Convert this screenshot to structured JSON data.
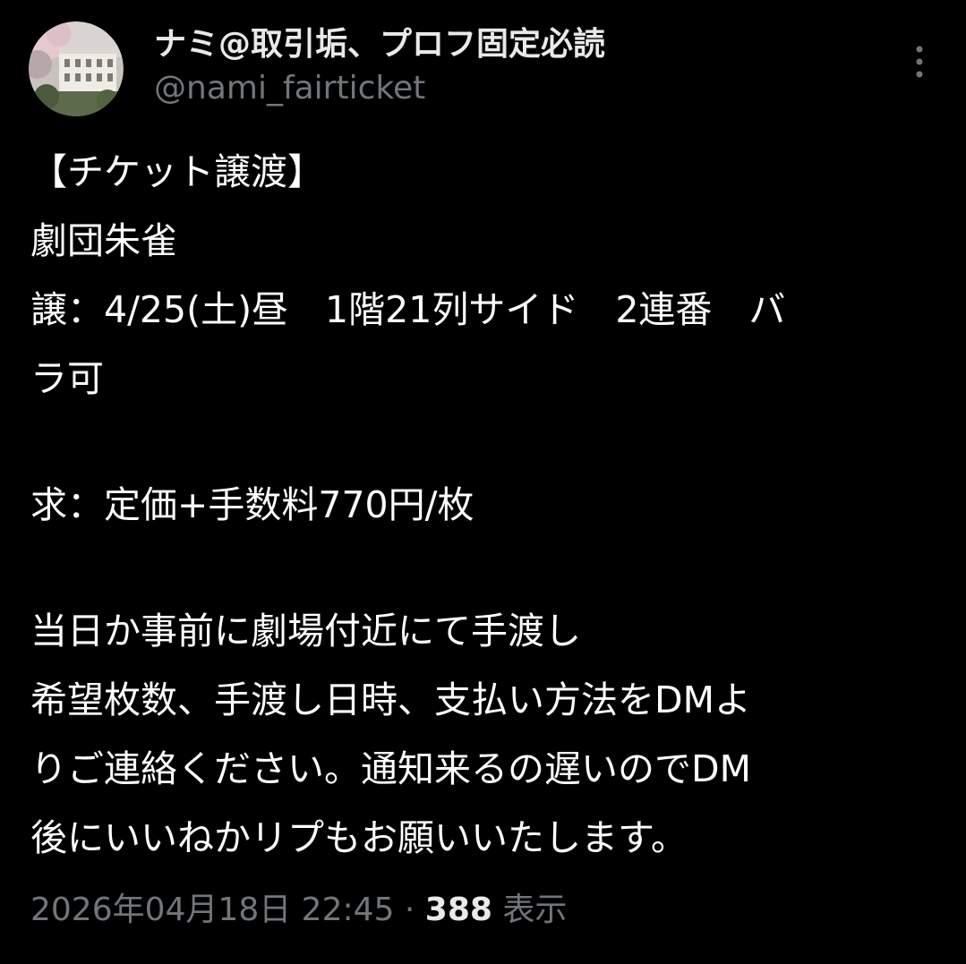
{
  "author": {
    "display_name": "ナミ@取引垢、プロフ固定必読",
    "handle": "@nami_fairticket",
    "avatar_icon": "profile-photo-building-icon"
  },
  "more_icon": "more-vertical-icon",
  "post": {
    "lines": [
      "【チケット譲渡】",
      "劇団朱雀",
      "譲：4/25(土)昼　1階21列サイド　2連番　バ",
      "ラ可",
      "",
      "求：定価+手数料770円/枚",
      "",
      "当日か事前に劇場付近にて手渡し",
      "希望枚数、手渡し日時、支払い方法をDMよ",
      "りご連絡ください。通知来るの遅いのでDM",
      "後にいいねかリプもお願いいたします。"
    ]
  },
  "meta": {
    "timestamp": "2026年04月18日 22:45",
    "separator": "·",
    "views_count": "388",
    "views_label": "表示"
  },
  "colors": {
    "background": "#000000",
    "primary_text": "#e7e9ea",
    "secondary_text": "#71767b"
  }
}
